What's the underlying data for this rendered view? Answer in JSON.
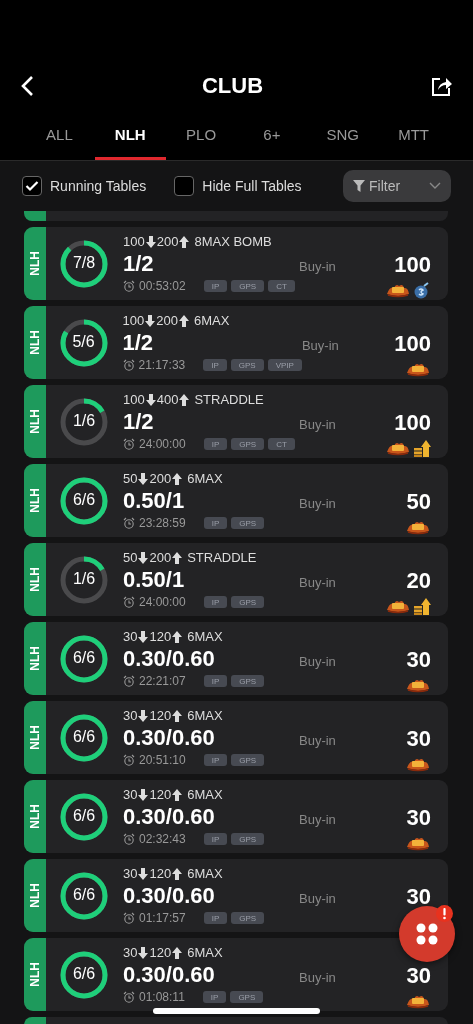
{
  "header": {
    "title": "CLUB"
  },
  "tabs": [
    {
      "label": "ALL",
      "selected": false
    },
    {
      "label": "NLH",
      "selected": true
    },
    {
      "label": "PLO",
      "selected": false
    },
    {
      "label": "6+",
      "selected": false
    },
    {
      "label": "SNG",
      "selected": false
    },
    {
      "label": "MTT",
      "selected": false
    }
  ],
  "filters": {
    "running_tables": {
      "label": "Running Tables",
      "checked": true
    },
    "hide_full_tables": {
      "label": "Hide Full Tables",
      "checked": false
    },
    "filter_button": "Filter"
  },
  "tables": [
    {
      "game": "NLH",
      "seats": "7/8",
      "level": 0.875,
      "min": "100",
      "max": "200",
      "label": "8MAX BOMB",
      "blinds": "1/2",
      "time": "00:53:02",
      "tags": [
        "IP",
        "GPS",
        "CT"
      ],
      "buyin_label": "Buy-in",
      "buyin": "100",
      "icons": [
        {
          "kind": "badbeat"
        },
        {
          "kind": "bomb"
        }
      ]
    },
    {
      "game": "NLH",
      "seats": "5/6",
      "level": 0.833,
      "min": "100",
      "max": "200",
      "label": "6MAX",
      "blinds": "1/2",
      "time": "21:17:33",
      "tags": [
        "IP",
        "GPS",
        "VPIP"
      ],
      "buyin_label": "Buy-in",
      "buyin": "100",
      "icons": [
        {
          "kind": "badbeat"
        }
      ]
    },
    {
      "game": "NLH",
      "seats": "1/6",
      "level": 0.167,
      "min": "100",
      "max": "400",
      "label": "STRADDLE",
      "blinds": "1/2",
      "time": "24:00:00",
      "tags": [
        "IP",
        "GPS",
        "CT"
      ],
      "buyin_label": "Buy-in",
      "buyin": "100",
      "icons": [
        {
          "kind": "badbeat"
        },
        {
          "kind": "boost"
        }
      ]
    },
    {
      "game": "NLH",
      "seats": "6/6",
      "level": 1,
      "min": "50",
      "max": "200",
      "label": "6MAX",
      "blinds": "0.50/1",
      "time": "23:28:59",
      "tags": [
        "IP",
        "GPS"
      ],
      "buyin_label": "Buy-in",
      "buyin": "50",
      "icons": [
        {
          "kind": "badbeat"
        }
      ]
    },
    {
      "game": "NLH",
      "seats": "1/6",
      "level": 0.167,
      "min": "50",
      "max": "200",
      "label": "STRADDLE",
      "blinds": "0.50/1",
      "time": "24:00:00",
      "tags": [
        "IP",
        "GPS"
      ],
      "buyin_label": "Buy-in",
      "buyin": "20",
      "icons": [
        {
          "kind": "badbeat"
        },
        {
          "kind": "boost"
        }
      ]
    },
    {
      "game": "NLH",
      "seats": "6/6",
      "level": 1,
      "min": "30",
      "max": "120",
      "label": "6MAX",
      "blinds": "0.30/0.60",
      "time": "22:21:07",
      "tags": [
        "IP",
        "GPS"
      ],
      "buyin_label": "Buy-in",
      "buyin": "30",
      "icons": [
        {
          "kind": "badbeat"
        }
      ]
    },
    {
      "game": "NLH",
      "seats": "6/6",
      "level": 1,
      "min": "30",
      "max": "120",
      "label": "6MAX",
      "blinds": "0.30/0.60",
      "time": "20:51:10",
      "tags": [
        "IP",
        "GPS"
      ],
      "buyin_label": "Buy-in",
      "buyin": "30",
      "icons": [
        {
          "kind": "badbeat"
        }
      ]
    },
    {
      "game": "NLH",
      "seats": "6/6",
      "level": 1,
      "min": "30",
      "max": "120",
      "label": "6MAX",
      "blinds": "0.30/0.60",
      "time": "02:32:43",
      "tags": [
        "IP",
        "GPS"
      ],
      "buyin_label": "Buy-in",
      "buyin": "30",
      "icons": [
        {
          "kind": "badbeat"
        }
      ]
    },
    {
      "game": "NLH",
      "seats": "6/6",
      "level": 1,
      "min": "30",
      "max": "120",
      "label": "6MAX",
      "blinds": "0.30/0.60",
      "time": "01:17:57",
      "tags": [
        "IP",
        "GPS"
      ],
      "buyin_label": "Buy-in",
      "buyin": "30"
    },
    {
      "game": "NLH",
      "seats": "6/6",
      "level": 1,
      "min": "30",
      "max": "120",
      "label": "6MAX",
      "blinds": "0.30/0.60",
      "time": "01:08:11",
      "tags": [
        "IP",
        "GPS"
      ],
      "buyin_label": "Buy-in",
      "buyin": "30",
      "icons": [
        {
          "kind": "badbeat"
        }
      ]
    }
  ]
}
